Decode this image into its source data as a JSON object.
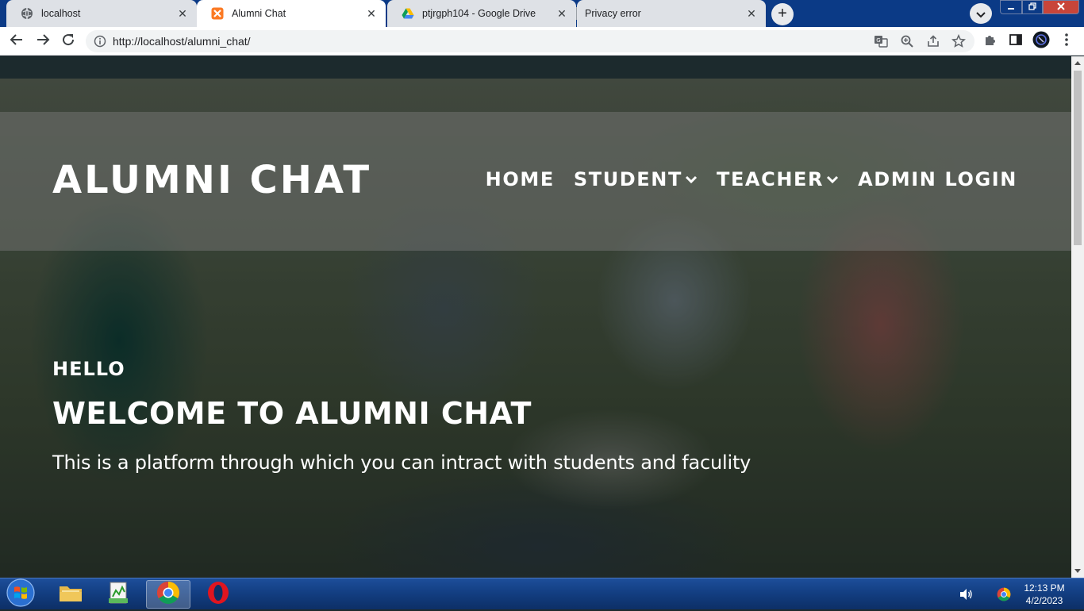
{
  "browser": {
    "tabs": [
      {
        "title": "localhost",
        "icon": "globe-icon",
        "active": false
      },
      {
        "title": "Alumni Chat",
        "icon": "xampp-icon",
        "active": true
      },
      {
        "title": "ptjrgph104 - Google Drive",
        "icon": "google-drive-icon",
        "active": false
      },
      {
        "title": "Privacy error",
        "icon": "",
        "active": false
      }
    ],
    "new_tab_label": "+",
    "close_glyph": "✕",
    "url": "http://localhost/alumni_chat/"
  },
  "site": {
    "brand": "ALUMNI CHAT",
    "nav": [
      {
        "label": "HOME",
        "dropdown": false
      },
      {
        "label": "STUDENT",
        "dropdown": true
      },
      {
        "label": "TEACHER",
        "dropdown": true
      },
      {
        "label": "ADMIN LOGIN",
        "dropdown": false
      }
    ],
    "hero": {
      "hello": "HELLO",
      "heading": "WELCOME TO ALUMNI CHAT",
      "tagline": "This is a platform through which you can intract with students and faculity"
    }
  },
  "taskbar": {
    "time": "12:13 PM",
    "date": "4/2/2023"
  },
  "colors": {
    "tab_strip": "#0b3a86",
    "active_tab": "#ffffff",
    "inactive_tab": "#dee1e6",
    "hero_text": "#ffffff",
    "navbar_overlay": "rgba(128,128,128,0.42)",
    "taskbar": "#123d80"
  }
}
